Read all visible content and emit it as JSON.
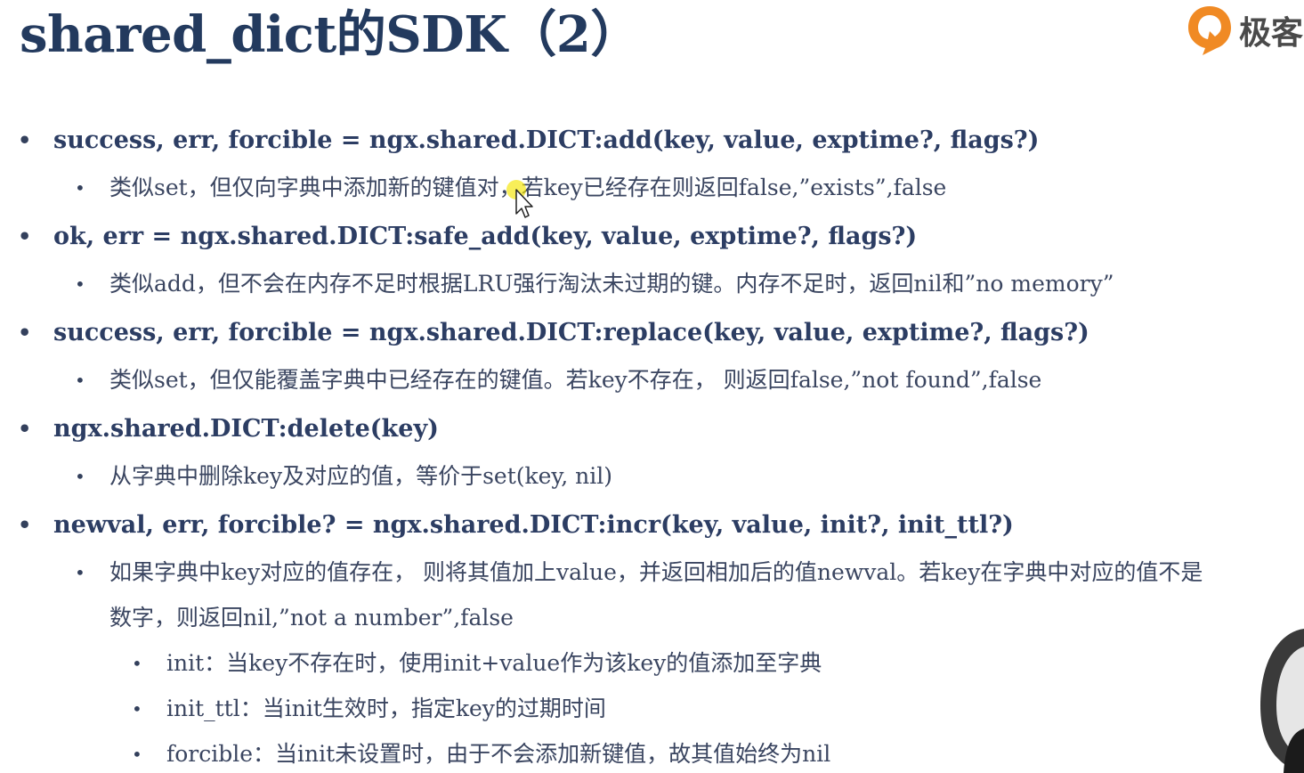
{
  "slide": {
    "title": "shared_dict的SDK（2）",
    "logo_text": "极客"
  },
  "bullets": [
    {
      "marker": "•",
      "text": "success, err, forcible = ngx.shared.DICT:add(key, value, exptime?, flags?)"
    },
    {
      "marker": "•",
      "text": "类似set，但仅向字典中添加新的键值对，若key已经存在则返回false,”exists”,false"
    },
    {
      "marker": "•",
      "text": "ok, err = ngx.shared.DICT:safe_add(key, value, exptime?, flags?)"
    },
    {
      "marker": "•",
      "text": "类似add，但不会在内存不足时根据LRU强行淘汰未过期的键。内存不足时，返回nil和”no memory”"
    },
    {
      "marker": "•",
      "text": "success, err, forcible = ngx.shared.DICT:replace(key, value, exptime?, flags?)"
    },
    {
      "marker": "•",
      "text": "类似set，但仅能覆盖字典中已经存在的键值。若key不存在， 则返回false,”not found”,false"
    },
    {
      "marker": "•",
      "text": "ngx.shared.DICT:delete(key)"
    },
    {
      "marker": "•",
      "text": "从字典中删除key及对应的值，等价于set(key, nil)"
    },
    {
      "marker": "•",
      "text": "newval, err, forcible? = ngx.shared.DICT:incr(key, value, init?, init_ttl?)"
    },
    {
      "marker": "•",
      "text": "如果字典中key对应的值存在， 则将其值加上value，并返回相加后的值newval。若key在字典中对应的值不是"
    },
    {
      "marker": "",
      "text": "数字，则返回nil,”not a number”,false"
    },
    {
      "marker": "•",
      "text": "init：当key不存在时，使用init+value作为该key的值添加至字典"
    },
    {
      "marker": "•",
      "text": "init_ttl：当init生效时，指定key的过期时间"
    },
    {
      "marker": "•",
      "text": "forcible：当init未设置时，由于不会添加新键值，故其值始终为nil"
    }
  ],
  "colors": {
    "title": "#233a5e",
    "heading_text": "#2c3d63",
    "body_text": "#3a4560",
    "logo_orange": "#f08a24",
    "cursor_highlight": "#f5e500"
  },
  "icons": {
    "logo": "geekbang-logo-icon",
    "cursor": "mouse-pointer-icon",
    "presenter": "presenter-video-overlay"
  }
}
